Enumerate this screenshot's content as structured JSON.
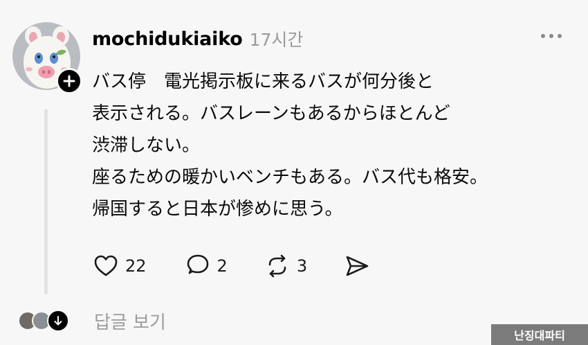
{
  "post": {
    "username": "mochidukiaiko",
    "timestamp": "17시간",
    "lines": [
      "バス停　電光掲示板に来るバスが何分後と",
      "表示される。バスレーンもあるからほとんど",
      "渋滞しない。",
      "座るための暖かいベンチもある。バス代も格安。",
      "帰国すると日本が惨めに思う。"
    ]
  },
  "actions": {
    "likes": "22",
    "replies": "2",
    "reposts": "3"
  },
  "footer": {
    "see_replies": "답글 보기"
  },
  "watermark": {
    "text": "난징대파티"
  },
  "icons": {
    "follow": "plus-icon",
    "more": "more-horizontal-icon",
    "like": "heart-icon",
    "reply": "comment-bubble-icon",
    "repost": "repost-icon",
    "share": "send-icon"
  }
}
